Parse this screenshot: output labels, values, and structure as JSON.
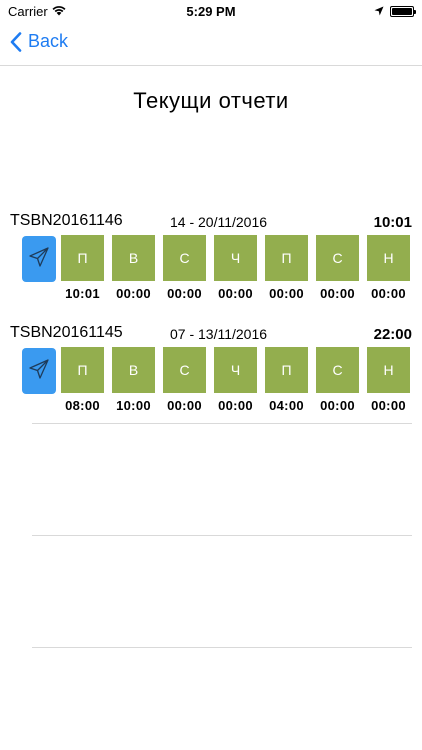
{
  "status_bar": {
    "carrier": "Carrier",
    "time": "5:29 PM",
    "battery_level": 1.0
  },
  "nav": {
    "back_label": "Back",
    "accent_color": "#1e7cf2"
  },
  "page": {
    "title": "Текущи отчети"
  },
  "day_color": "#93ae4e",
  "send_color": "#3a9af0",
  "reports": [
    {
      "id": "TSBN20161146",
      "period": "14 - 20/11/2016",
      "total": "10:01",
      "days": [
        {
          "label": "П",
          "hours": "10:01"
        },
        {
          "label": "В",
          "hours": "00:00"
        },
        {
          "label": "С",
          "hours": "00:00"
        },
        {
          "label": "Ч",
          "hours": "00:00"
        },
        {
          "label": "П",
          "hours": "00:00"
        },
        {
          "label": "С",
          "hours": "00:00"
        },
        {
          "label": "Н",
          "hours": "00:00"
        }
      ]
    },
    {
      "id": "TSBN20161145",
      "period": "07 - 13/11/2016",
      "total": "22:00",
      "days": [
        {
          "label": "П",
          "hours": "08:00"
        },
        {
          "label": "В",
          "hours": "10:00"
        },
        {
          "label": "С",
          "hours": "00:00"
        },
        {
          "label": "Ч",
          "hours": "00:00"
        },
        {
          "label": "П",
          "hours": "04:00"
        },
        {
          "label": "С",
          "hours": "00:00"
        },
        {
          "label": "Н",
          "hours": "00:00"
        }
      ]
    }
  ]
}
